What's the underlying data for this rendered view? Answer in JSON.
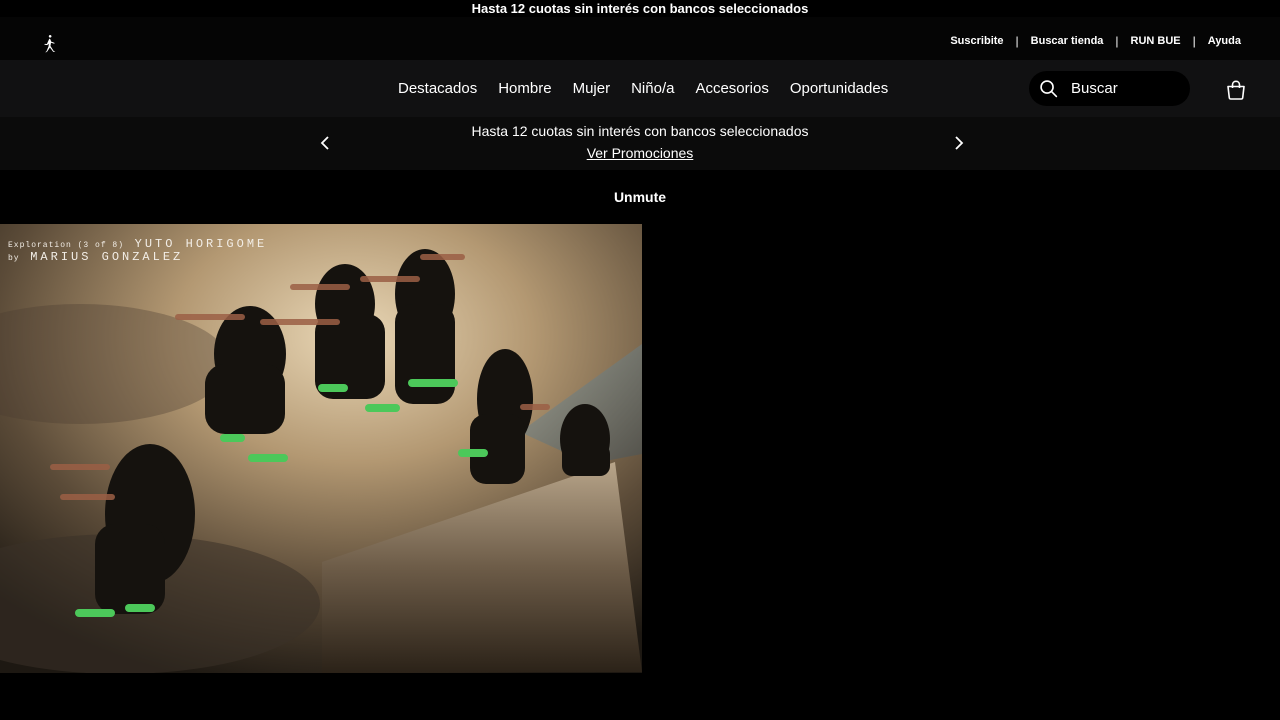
{
  "top_banner": {
    "text": "Hasta 12 cuotas sin interés con bancos seleccionados"
  },
  "utility": {
    "links": [
      "Suscribite",
      "Buscar tienda",
      "RUN BUE",
      "Ayuda"
    ]
  },
  "nav": {
    "items": [
      "Destacados",
      "Hombre",
      "Mujer",
      "Niño/a",
      "Accesorios",
      "Oportunidades"
    ],
    "search_placeholder": "Buscar"
  },
  "promo": {
    "text": "Hasta 12 cuotas sin interés con bancos seleccionados",
    "link": "Ver Promociones"
  },
  "video": {
    "unmute_label": "Unmute",
    "caption_small": "Exploration (3 of 8)",
    "caption_athlete": "YUTO HORIGOME",
    "caption_by": "by",
    "caption_author": "MARIUS GONZALEZ"
  },
  "icons": {
    "jordan": "jumpman-icon",
    "brand": "swoosh-icon",
    "search": "search-icon",
    "bag": "bag-icon",
    "prev": "chevron-left-icon",
    "next": "chevron-right-icon"
  }
}
